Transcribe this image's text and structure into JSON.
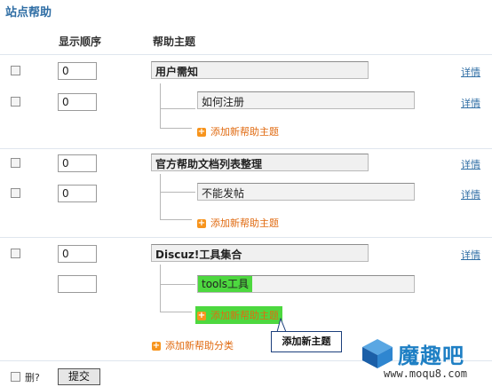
{
  "title": "站点帮助",
  "headers": {
    "order": "显示顺序",
    "topic": "帮助主题"
  },
  "rows": [
    {
      "order": "0",
      "topic": "用户需知",
      "detail": "详情"
    },
    {
      "order": "0",
      "topic": "如何注册",
      "detail": "详情"
    },
    {
      "add_label": "添加新帮助主题"
    },
    {
      "order": "0",
      "topic": "官方帮助文档列表整理",
      "detail": "详情"
    },
    {
      "order": "0",
      "topic": "不能发帖",
      "detail": "详情"
    },
    {
      "add_label": "添加新帮助主题"
    },
    {
      "order": "0",
      "topic": "Discuz!工具集合",
      "detail": "详情"
    },
    {
      "order": "",
      "topic": "tools工具"
    },
    {
      "add_label": "添加新帮助主题"
    }
  ],
  "add_category": "添加新帮助分类",
  "callout": "添加新主题",
  "footer": {
    "delete_label": "删?",
    "submit_label": "提交"
  },
  "watermark": {
    "brand": "魔趣吧",
    "url": "www.moqu8.com"
  },
  "colors": {
    "accent": "#2e6da4",
    "add_link": "#e06a10",
    "highlight": "#4dd83f"
  }
}
